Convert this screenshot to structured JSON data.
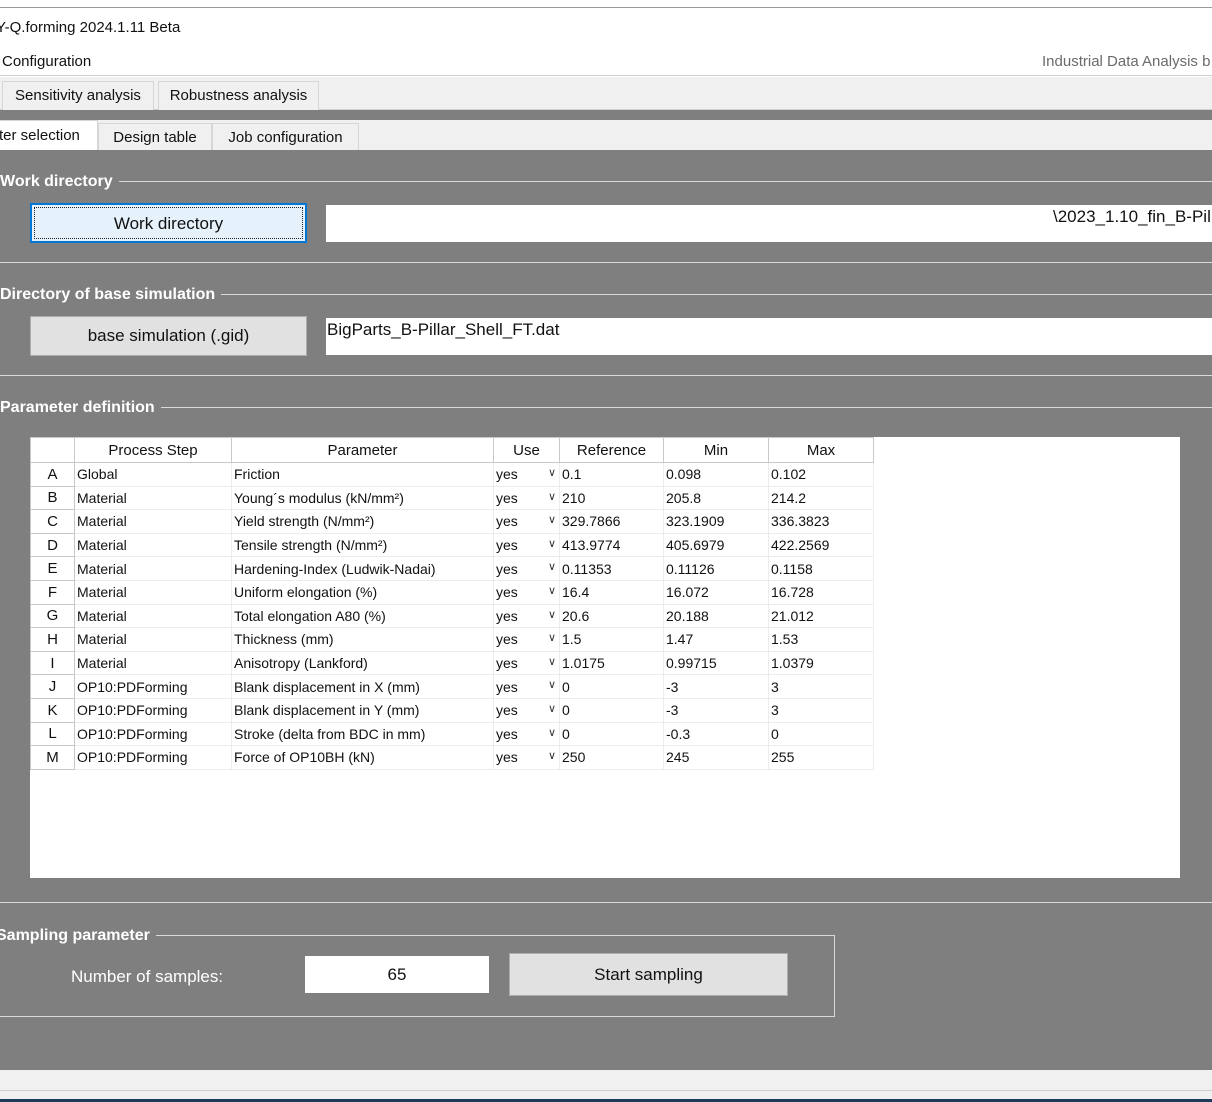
{
  "window": {
    "title": "Y-Q.forming 2024.1.11 Beta"
  },
  "menu": {
    "configuration": "Configuration",
    "brand": "Industrial Data Analysis b"
  },
  "top_tabs": [
    "Sensitivity analysis",
    "Robustness analysis"
  ],
  "sub_tabs": [
    "ter selection",
    "Design table",
    "Job configuration"
  ],
  "work_directory": {
    "group_label": "Work directory",
    "button_label": "Work directory",
    "path_value": "\\2023_1.10_fin_B-Pil"
  },
  "base_simulation": {
    "group_label": "Directory of base simulation",
    "button_label": "base simulation (.gid)",
    "file_value": "BigParts_B-Pillar_Shell_FT.dat"
  },
  "parameter_definition": {
    "group_label": "Parameter definition",
    "columns": [
      "Process Step",
      "Parameter",
      "Use",
      "Reference",
      "Min",
      "Max"
    ],
    "rows": [
      {
        "id": "A",
        "step": "Global",
        "param": "Friction",
        "use": "yes",
        "ref": "0.1",
        "min": "0.098",
        "max": "0.102"
      },
      {
        "id": "B",
        "step": "Material",
        "param": "Young´s modulus (kN/mm²)",
        "use": "yes",
        "ref": "210",
        "min": "205.8",
        "max": "214.2"
      },
      {
        "id": "C",
        "step": "Material",
        "param": "Yield strength (N/mm²)",
        "use": "yes",
        "ref": "329.7866",
        "min": "323.1909",
        "max": "336.3823"
      },
      {
        "id": "D",
        "step": "Material",
        "param": "Tensile strength (N/mm²)",
        "use": "yes",
        "ref": "413.9774",
        "min": "405.6979",
        "max": "422.2569"
      },
      {
        "id": "E",
        "step": "Material",
        "param": "Hardening-Index (Ludwik-Nadai)",
        "use": "yes",
        "ref": "0.11353",
        "min": "0.11126",
        "max": "0.1158"
      },
      {
        "id": "F",
        "step": "Material",
        "param": "Uniform elongation (%)",
        "use": "yes",
        "ref": "16.4",
        "min": "16.072",
        "max": "16.728"
      },
      {
        "id": "G",
        "step": "Material",
        "param": "Total elongation A80 (%)",
        "use": "yes",
        "ref": "20.6",
        "min": "20.188",
        "max": "21.012"
      },
      {
        "id": "H",
        "step": "Material",
        "param": "Thickness (mm)",
        "use": "yes",
        "ref": "1.5",
        "min": "1.47",
        "max": "1.53"
      },
      {
        "id": "I",
        "step": "Material",
        "param": "Anisotropy (Lankford)",
        "use": "yes",
        "ref": "1.0175",
        "min": "0.99715",
        "max": "1.0379"
      },
      {
        "id": "J",
        "step": "OP10:PDForming",
        "param": "Blank displacement in X (mm)",
        "use": "yes",
        "ref": "0",
        "min": "-3",
        "max": "3"
      },
      {
        "id": "K",
        "step": "OP10:PDForming",
        "param": "Blank displacement in Y (mm)",
        "use": "yes",
        "ref": "0",
        "min": "-3",
        "max": "3"
      },
      {
        "id": "L",
        "step": "OP10:PDForming",
        "param": "Stroke (delta from BDC in mm)",
        "use": "yes",
        "ref": "0",
        "min": "-0.3",
        "max": "0"
      },
      {
        "id": "M",
        "step": "OP10:PDForming",
        "param": "Force of OP10BH (kN)",
        "use": "yes",
        "ref": "250",
        "min": "245",
        "max": "255"
      }
    ]
  },
  "sampling": {
    "group_label": "Sampling parameter",
    "samples_label": "Number of samples:",
    "samples_value": "65",
    "start_button": "Start sampling"
  },
  "colors": {
    "panel_bg": "#7f7f7f",
    "focus_border": "#0078d7",
    "button_bg": "#e1e1e1"
  }
}
